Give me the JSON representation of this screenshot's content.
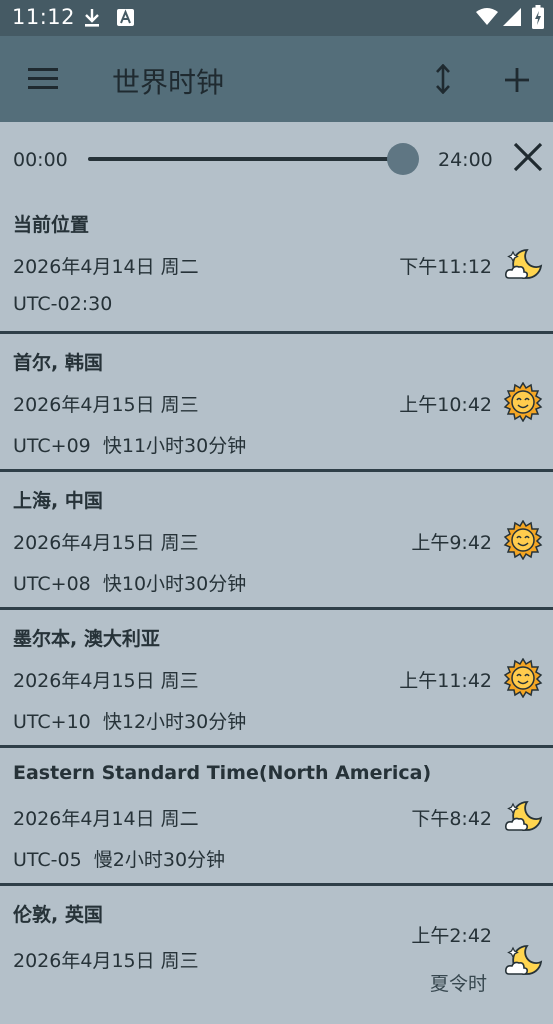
{
  "status": {
    "time": "11:12"
  },
  "appbar": {
    "title": "世界时钟"
  },
  "slider": {
    "min_label": "00:00",
    "max_label": "24:00",
    "value_fraction": 1.0
  },
  "cards": [
    {
      "name": "当前位置",
      "date": "2026年4月14日 周二",
      "time": "下午11:12",
      "offset": "UTC-02:30",
      "diff": "",
      "icon": "moon-cloud-icon"
    },
    {
      "name": "首尔, 韩国",
      "date": "2026年4月15日 周三",
      "time": "上午10:42",
      "offset": "UTC+09",
      "diff": "快11小时30分钟",
      "icon": "sun-icon"
    },
    {
      "name": "上海, 中国",
      "date": "2026年4月15日 周三",
      "time": "上午9:42",
      "offset": "UTC+08",
      "diff": "快10小时30分钟",
      "icon": "sun-icon"
    },
    {
      "name": "墨尔本, 澳大利亚",
      "date": "2026年4月15日 周三",
      "time": "上午11:42",
      "offset": "UTC+10",
      "diff": "快12小时30分钟",
      "icon": "sun-icon"
    },
    {
      "name": "Eastern Standard Time(North America)",
      "date": "2026年4月14日 周二",
      "time": "下午8:42",
      "offset": "UTC-05",
      "diff": "慢2小时30分钟",
      "icon": "moon-cloud-icon"
    },
    {
      "name": "伦敦, 英国",
      "date": "2026年4月15日 周三",
      "time": "上午2:42",
      "offset": "",
      "diff": "",
      "extra": "夏令时",
      "icon": "moon-cloud-icon"
    }
  ]
}
